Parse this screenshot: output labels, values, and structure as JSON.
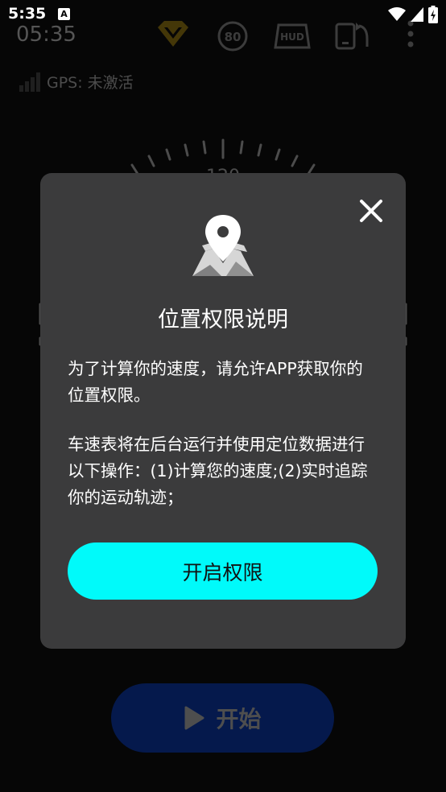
{
  "status_bar": {
    "time": "5:35",
    "notification_icon": "A"
  },
  "app": {
    "clock": "05:35",
    "speed_limit": "80",
    "hud_label": "HUD",
    "gps_status": "GPS: 未激活",
    "gauge_top_number": "120",
    "start_button_label": "开始",
    "colors": {
      "accent": "#e6b800",
      "start_button": "#0a2f8a"
    }
  },
  "dialog": {
    "title": "位置权限说明",
    "paragraph_1": "为了计算你的速度，请允许APP获取你的 位置权限。",
    "paragraph_2": "车速表将在后台运行并使用定位数据进行 以下操作：(1)计算您的速度;(2)实时追踪 你的运动轨迹；",
    "grant_button_label": "开启权限",
    "close_icon": "close-icon",
    "colors": {
      "background": "#3b3b3c",
      "button": "#00fafa"
    }
  }
}
